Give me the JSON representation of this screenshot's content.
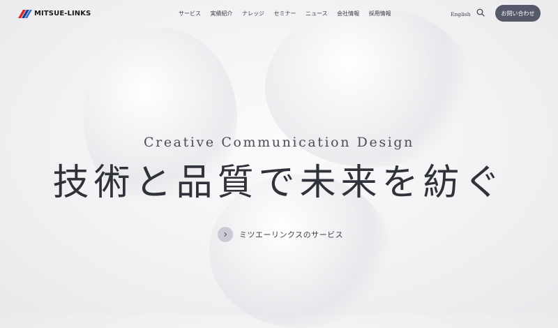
{
  "header": {
    "logo_text": "MITSUE-LINKS",
    "nav": [
      "サービス",
      "実績紹介",
      "ナレッジ",
      "セミナー",
      "ニュース",
      "会社情報",
      "採用情報"
    ],
    "language_link": "English",
    "contact_button": "お問い合わせ"
  },
  "hero": {
    "subtitle": "Creative Communication Design",
    "headline": "技術と品質で未来を紡ぐ",
    "cta_label": "ミツエーリンクスのサービス"
  },
  "colors": {
    "accent_button": "#55596a",
    "logo_red": "#d7262e",
    "logo_blue": "#1d3f8f",
    "text": "#3a3d45"
  }
}
